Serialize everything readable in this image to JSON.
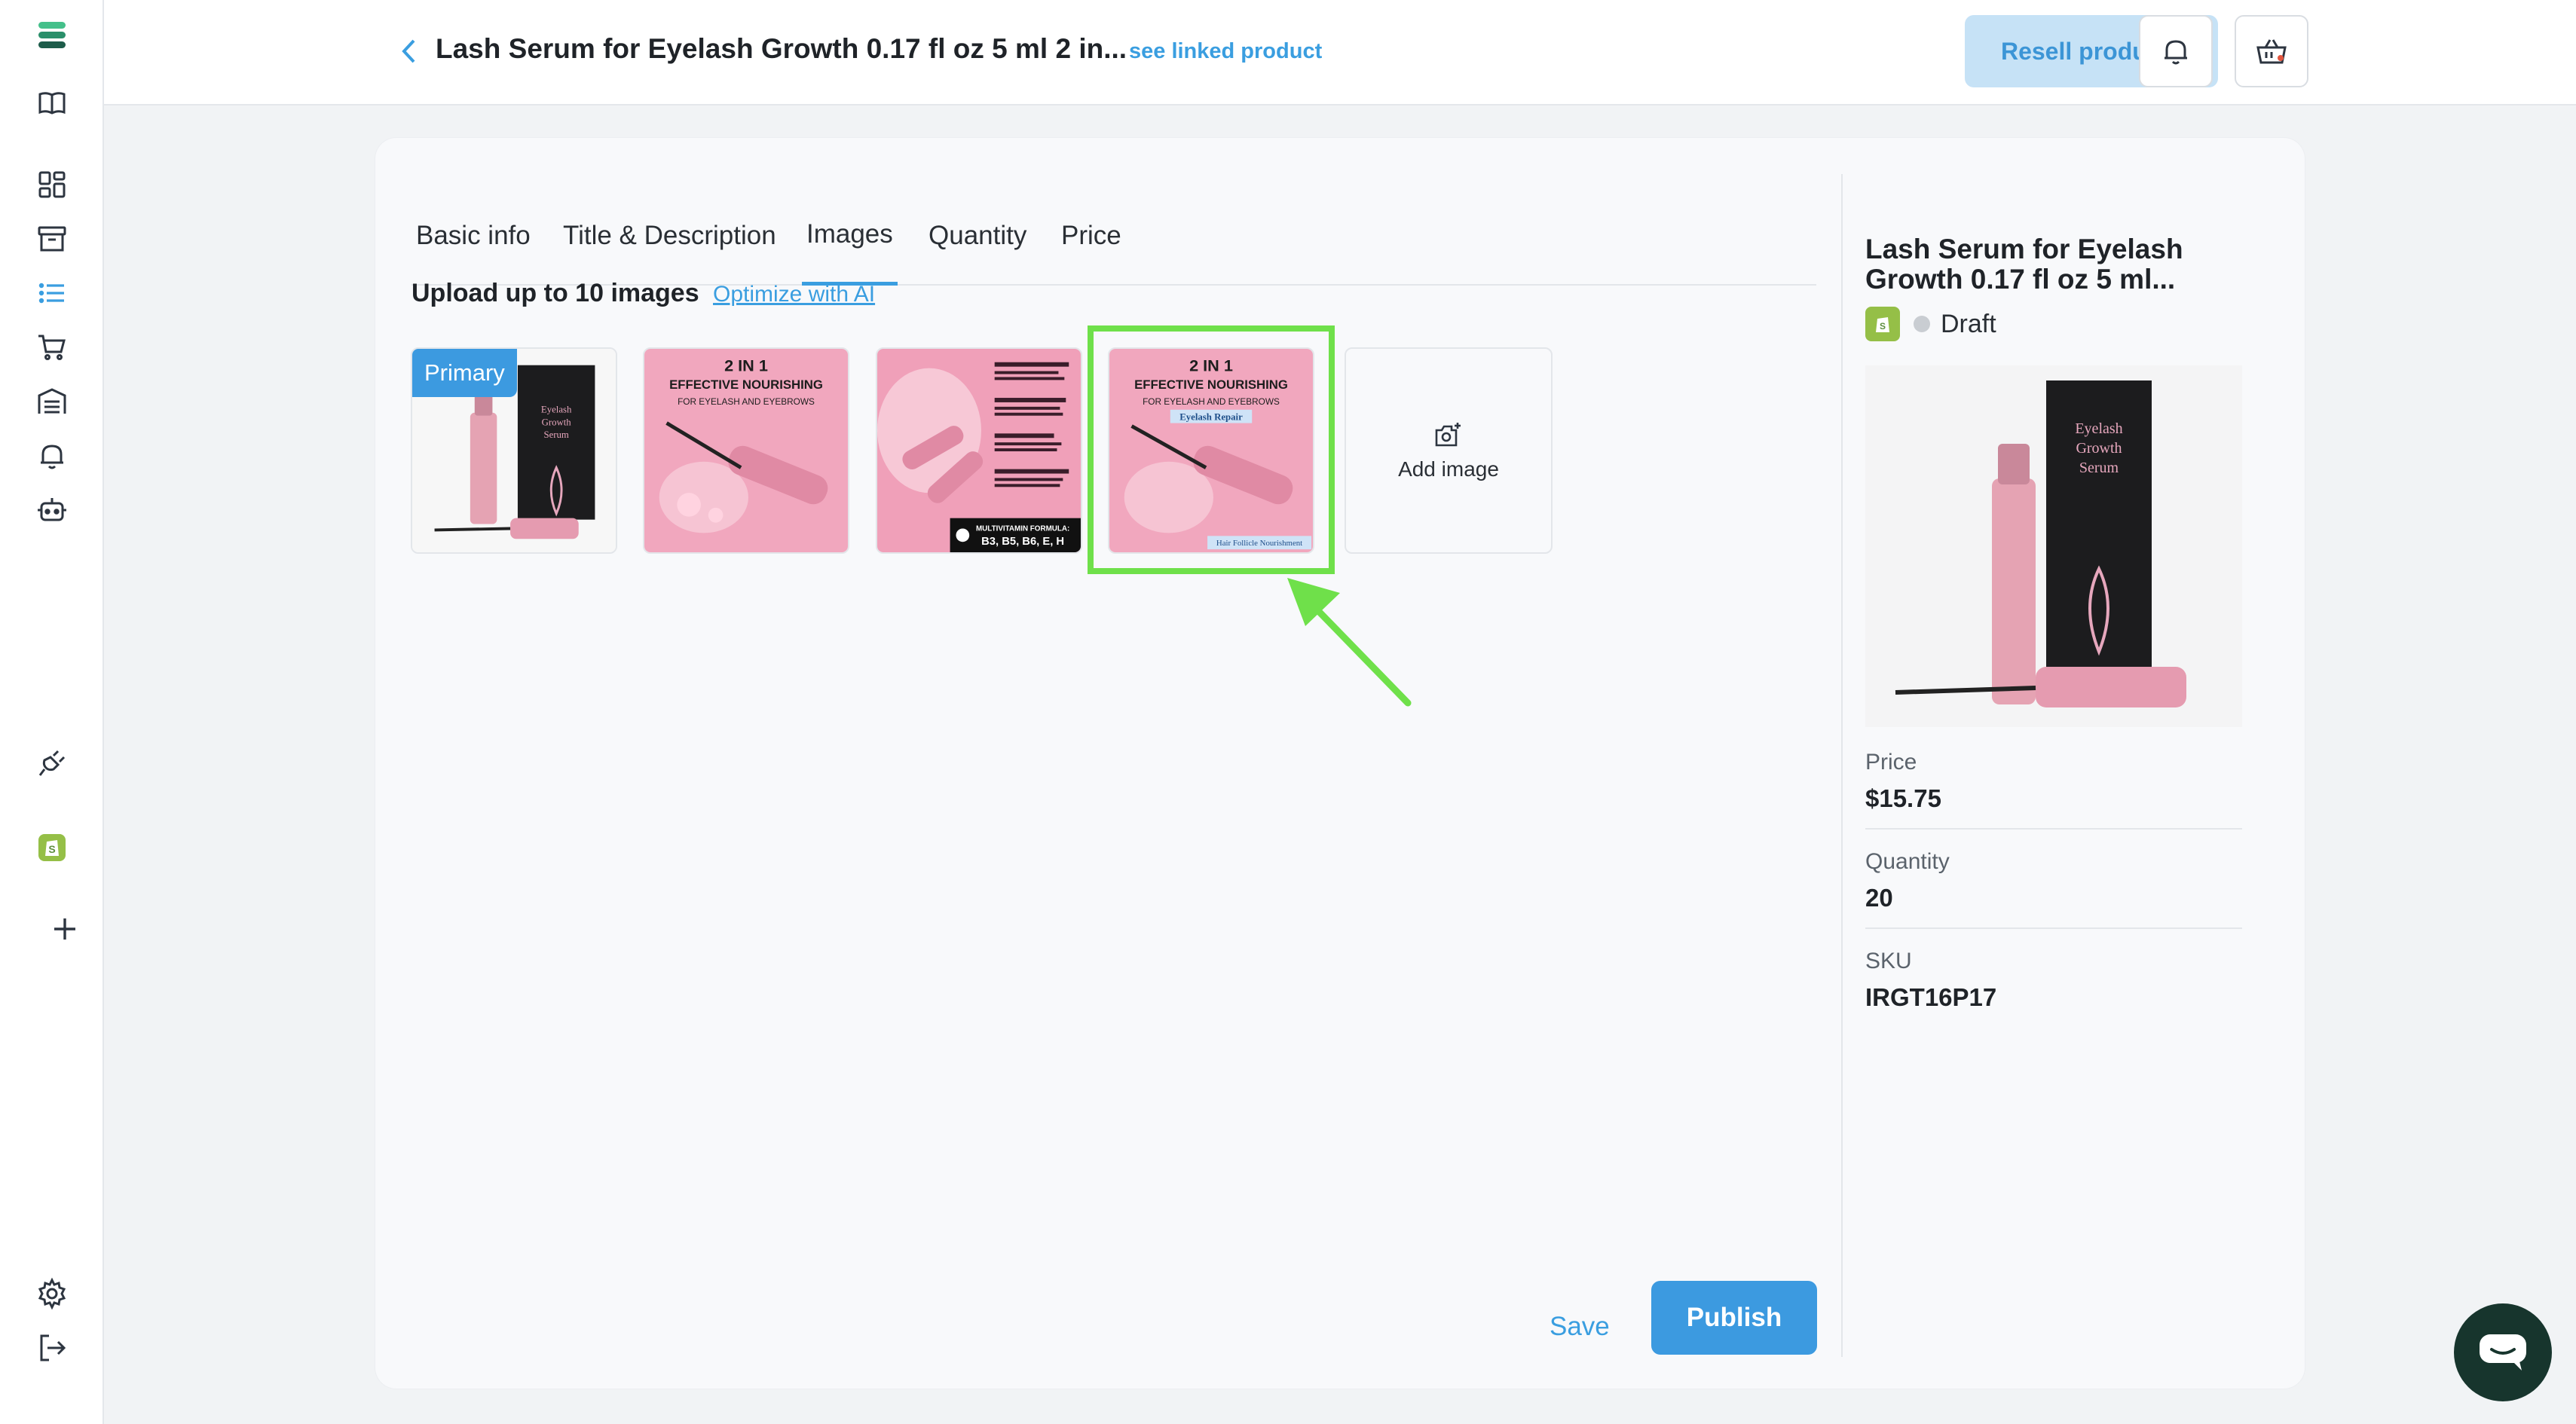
{
  "header": {
    "title": "Lash Serum for Eyelash Growth 0.17 fl oz 5 ml 2 in...",
    "linked_link": "see linked product",
    "resell_label": "Resell products"
  },
  "tabs": [
    {
      "label": "Basic info"
    },
    {
      "label": "Title & Description"
    },
    {
      "label": "Images",
      "active": true
    },
    {
      "label": "Quantity"
    },
    {
      "label": "Price"
    }
  ],
  "images_section": {
    "upload_label": "Upload up to 10 images",
    "optimize_label": "Optimize with AI",
    "primary_badge": "Primary",
    "add_image_label": "Add image",
    "thumb_text": {
      "box_line1": "Eyelash",
      "box_line2": "Growth",
      "box_line3": "Serum",
      "heading1": "2 IN 1",
      "heading2": "EFFECTIVE NOURISHING",
      "heading3": "FOR EYELASH AND EYEBROWS",
      "ribbon1": "Eyelash Repair",
      "ribbon2": "Hair Follicle Nourishment",
      "formula_label": "MULTIVITAMIN FORMULA:",
      "formula_value": "B3, B5, B6, E, H"
    }
  },
  "actions": {
    "save_label": "Save",
    "publish_label": "Publish"
  },
  "summary": {
    "title": "Lash Serum for Eyelash Growth 0.17 fl oz 5 ml...",
    "status": "Draft",
    "price_label": "Price",
    "price_value": "$15.75",
    "quantity_label": "Quantity",
    "quantity_value": "20",
    "sku_label": "SKU",
    "sku_value": "IRGT16P17"
  },
  "colors": {
    "accent": "#3c9ae0",
    "highlight": "#6fe04a",
    "shopify_green": "#95bf47",
    "chat_bg": "#17352d"
  }
}
